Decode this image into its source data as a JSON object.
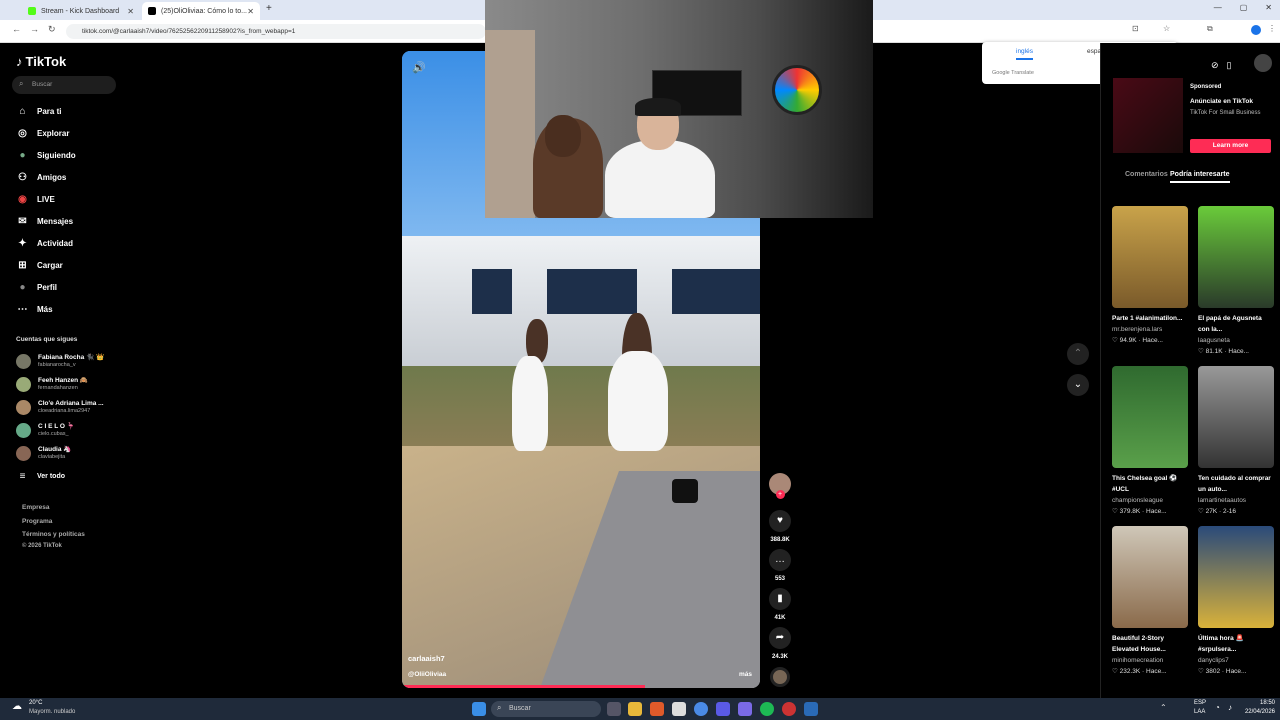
{
  "browser": {
    "tabs": [
      {
        "title": "Stream - Kick Dashboard",
        "active": false
      },
      {
        "title": "(25)OliOliviaa: Cómo lo to...",
        "active": true
      }
    ],
    "new_tab": "+",
    "url": "tiktok.com/@carlaaish7/video/7625256220911258902?is_from_webapp=1",
    "window_controls": [
      "—",
      "▢",
      "✕"
    ]
  },
  "translate": {
    "lang_from": "inglés",
    "lang_to": "español",
    "brand": "Google Translate"
  },
  "sidebar": {
    "logo": "TikTok",
    "search_placeholder": "Buscar",
    "nav": [
      {
        "label": "Para ti",
        "icon": "home-icon",
        "glyph": "⌂"
      },
      {
        "label": "Explorar",
        "icon": "compass-icon",
        "glyph": "◎"
      },
      {
        "label": "Siguiendo",
        "icon": "following-icon",
        "glyph": "●"
      },
      {
        "label": "Amigos",
        "icon": "friends-icon",
        "glyph": "⚇"
      },
      {
        "label": "LIVE",
        "icon": "live-icon",
        "glyph": "◉"
      },
      {
        "label": "Mensajes",
        "icon": "messages-icon",
        "glyph": "✉"
      },
      {
        "label": "Actividad",
        "icon": "activity-icon",
        "glyph": "✦"
      },
      {
        "label": "Cargar",
        "icon": "upload-icon",
        "glyph": "⊞"
      },
      {
        "label": "Perfil",
        "icon": "profile-icon",
        "glyph": "●"
      },
      {
        "label": "Más",
        "icon": "more-icon",
        "glyph": "⋯"
      }
    ],
    "following_title": "Cuentas que sigues",
    "accounts": [
      {
        "name": "Fabiana Rocha 🐈‍⬛ 👑",
        "handle": "fabianarocha_v"
      },
      {
        "name": "Feeh Hanzen 🙈",
        "handle": "fernandahanzen"
      },
      {
        "name": "Clo'e Adriana Lima ...",
        "handle": "cloeadriana.lima2947"
      },
      {
        "name": "C I E L O 🦩",
        "handle": "cielo.cubas_"
      },
      {
        "name": "Claudia 🦄",
        "handle": "claviabejita"
      }
    ],
    "see_all": "Ver todo",
    "footer": [
      "Empresa",
      "Programa",
      "Términos y políticas",
      "© 2026 TikTok"
    ]
  },
  "video": {
    "username": "carlaaish7",
    "sound": "@OliiOliviaa",
    "more": "más",
    "progress": 0.68,
    "actions": [
      {
        "icon": "heart-icon",
        "glyph": "♥",
        "count": "388.8K"
      },
      {
        "icon": "comment-icon",
        "glyph": "…",
        "count": "553"
      },
      {
        "icon": "bookmark-icon",
        "glyph": "▮",
        "count": "41K"
      },
      {
        "icon": "share-icon",
        "glyph": "➦",
        "count": "24.3K"
      }
    ]
  },
  "right": {
    "sponsored": "Sponsored",
    "ad_title": "Anúnciate en TikTok",
    "ad_subtitle": "TikTok For Small Business",
    "learn_more": "Learn more",
    "tabs": [
      "Comentarios",
      "Podría interesarte"
    ],
    "cards": [
      {
        "title": "Parte 1 #alanimatilon...",
        "user": "mr.berenjena.lars",
        "stat": "♡ 94.9K · Hace...",
        "colors": [
          "#7a5a2a",
          "#c9a34a"
        ]
      },
      {
        "title": "El papá de Agusneta con la...",
        "user": "laagusneta",
        "stat": "♡ 81.1K · Hace...",
        "colors": [
          "#2a3a2a",
          "#6acb3a"
        ]
      },
      {
        "title": "This Chelsea goal ⚽ #UCL",
        "user": "championsleague",
        "stat": "♡ 379.8K · Hace...",
        "colors": [
          "#2f6a2f",
          "#5aa04a"
        ]
      },
      {
        "title": "Ten cuidado al comprar un auto...",
        "user": "lamartinetaautos",
        "stat": "♡ 27K · 2-16",
        "colors": [
          "#555",
          "#999"
        ]
      },
      {
        "title": "Beautiful 2-Story Elevated House...",
        "user": "minihomecreation",
        "stat": "♡ 232.3K · Hace...",
        "colors": [
          "#8a6a4a",
          "#cfc7b8"
        ]
      },
      {
        "title": "Última hora 🚨 #srpulsera...",
        "user": "danyclips7",
        "stat": "♡ 3802 · Hace...",
        "colors": [
          "#2a4a7a",
          "#d9b23a"
        ]
      }
    ]
  },
  "taskbar": {
    "weather_temp": "20°C",
    "weather_desc": "Mayorm. nublado",
    "search": "Buscar",
    "lang": "ESP",
    "lang2": "LAA",
    "time": "18:50",
    "date": "22/04/2026"
  }
}
